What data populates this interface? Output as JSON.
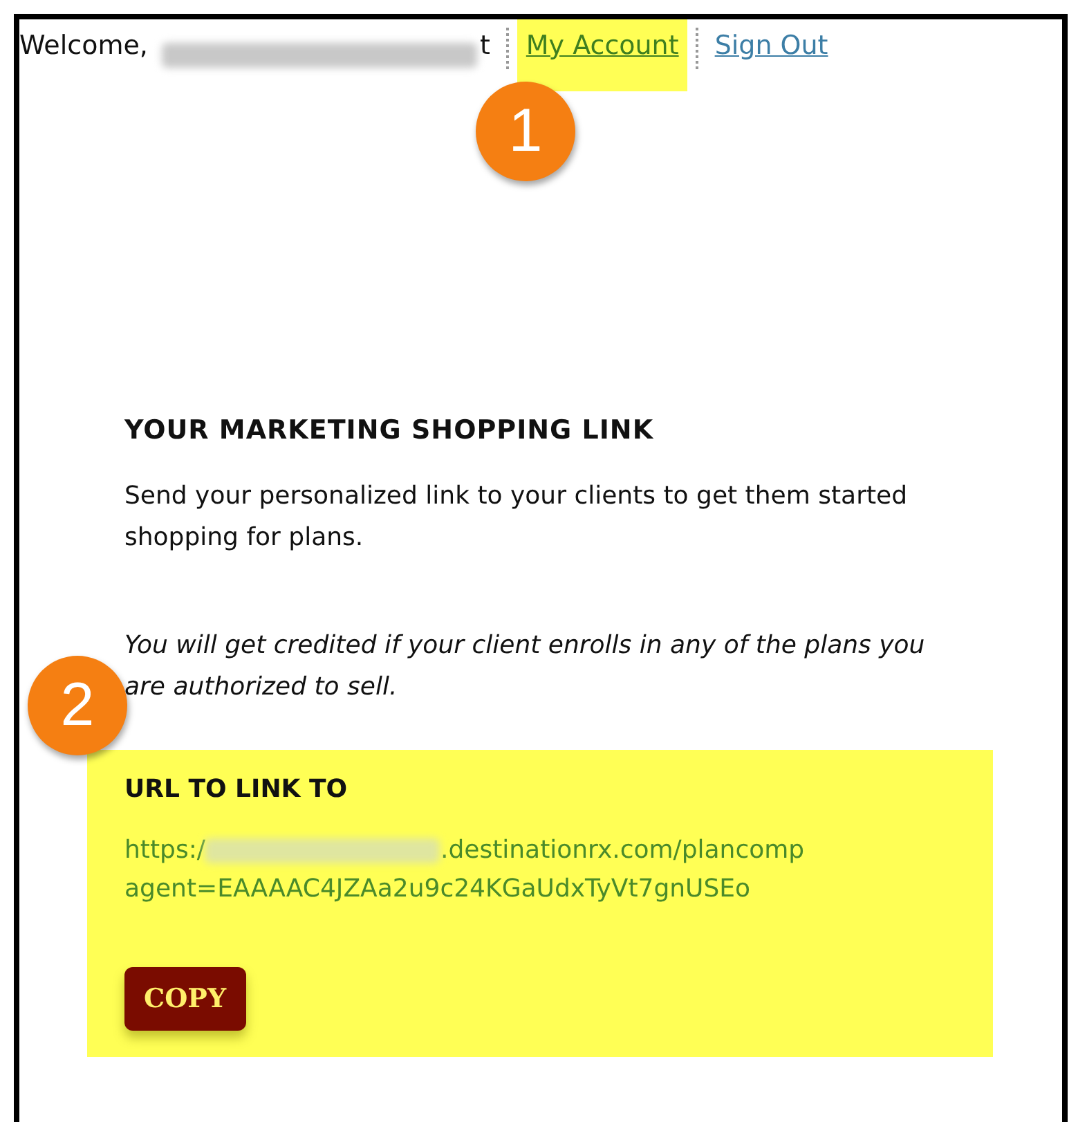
{
  "header": {
    "greeting": "Welcome,",
    "name_tail": "t",
    "links": [
      {
        "label": "My Account",
        "highlighted": true
      },
      {
        "label": "Sign Out",
        "highlighted": false
      }
    ]
  },
  "callouts": [
    {
      "label": "1"
    },
    {
      "label": "2"
    }
  ],
  "section": {
    "title": "YOUR MARKETING SHOPPING LINK",
    "description": "Send your personalized link to your clients to get them started shopping for plans.",
    "note": "You will get credited if your client enrolls in any of the plans you are authorized to sell."
  },
  "link_box": {
    "title": "URL TO LINK TO",
    "url_prefix": "https:/",
    "url_domain": ".destinationrx.com/plancomp",
    "url_line_2": "agent=EAAAAC4JZAa2u9c24KGaUdxTyVt7gnUSEo",
    "button": "COPY"
  }
}
